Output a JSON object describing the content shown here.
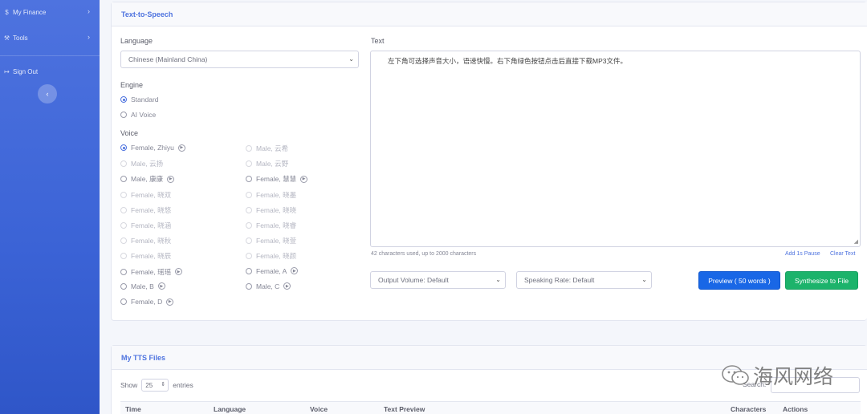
{
  "sidebar": {
    "items": [
      {
        "icon": "dollar-icon",
        "glyph": "$",
        "label": "My Finance"
      },
      {
        "icon": "wrench-icon",
        "glyph": "⚒",
        "label": "Tools"
      },
      {
        "icon": "sign-out-icon",
        "glyph": "↦",
        "label": "Sign Out"
      }
    ],
    "toggle_glyph": "‹"
  },
  "tts": {
    "title": "Text-to-Speech",
    "language_label": "Language",
    "language_value": "Chinese (Mainland China)",
    "engine_label": "Engine",
    "engines": [
      {
        "label": "Standard",
        "checked": true
      },
      {
        "label": "AI Voice",
        "checked": false
      }
    ],
    "voice_label": "Voice",
    "voices_left": [
      {
        "label": "Female, Zhiyu",
        "state": "checked",
        "play": true
      },
      {
        "label": "Male, 云扬",
        "state": "disabled",
        "play": false
      },
      {
        "label": "Male, 康康",
        "state": "normal",
        "play": true
      },
      {
        "label": "Female, 晓双",
        "state": "disabled",
        "play": false
      },
      {
        "label": "Female, 晓悠",
        "state": "disabled",
        "play": false
      },
      {
        "label": "Female, 晓涵",
        "state": "disabled",
        "play": false
      },
      {
        "label": "Female, 晓秋",
        "state": "disabled",
        "play": false
      },
      {
        "label": "Female, 晓辰",
        "state": "disabled",
        "play": false
      },
      {
        "label": "Female, 瑶瑶",
        "state": "normal",
        "play": true
      },
      {
        "label": "Male, B",
        "state": "normal",
        "play": true
      },
      {
        "label": "Female, D",
        "state": "normal",
        "play": true
      }
    ],
    "voices_right": [
      {
        "label": "Male, 云希",
        "state": "disabled",
        "play": false
      },
      {
        "label": "Male, 云野",
        "state": "disabled",
        "play": false
      },
      {
        "label": "Female, 慧慧",
        "state": "normal",
        "play": true
      },
      {
        "label": "Female, 晓墨",
        "state": "disabled",
        "play": false
      },
      {
        "label": "Female, 晓晓",
        "state": "disabled",
        "play": false
      },
      {
        "label": "Female, 晓睿",
        "state": "disabled",
        "play": false
      },
      {
        "label": "Female, 晓萱",
        "state": "disabled",
        "play": false
      },
      {
        "label": "Female, 晓颜",
        "state": "disabled",
        "play": false
      },
      {
        "label": "Female, A",
        "state": "normal",
        "play": true
      },
      {
        "label": "Male, C",
        "state": "normal",
        "play": true
      }
    ],
    "play_glyph": "▶",
    "text_label": "Text",
    "text_value": "左下角可选择声音大小，语速快慢。右下角绿色按钮点击后直接下载MP3文件。",
    "char_count": "42 characters used, up to 2000 characters",
    "add_pause": "Add 1s Pause",
    "clear_text": "Clear Text",
    "output_volume": "Output Volume: Default",
    "speaking_rate": "Speaking Rate: Default",
    "preview_btn": "Preview ( 50 words )",
    "synthesize_btn": "Synthesize to File"
  },
  "files": {
    "title": "My TTS Files",
    "show_label": "Show",
    "page_size": "25",
    "entries_label": "entries",
    "search_label": "Search:",
    "columns": [
      "Time",
      "Language",
      "Voice",
      "Text Preview",
      "Characters",
      "Actions"
    ]
  },
  "caret_glyph": "⌄",
  "watermark": "海风网络",
  "colors": {
    "primary": "#4e73df",
    "preview": "#1967e6",
    "synthesize": "#1cb36b"
  }
}
